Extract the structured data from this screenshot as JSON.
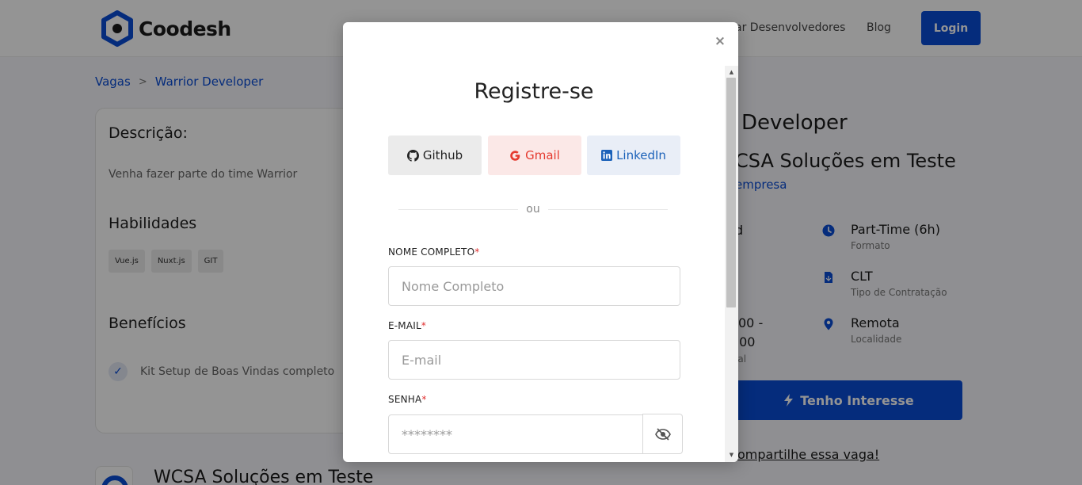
{
  "header": {
    "brand": "Coodesh",
    "nav_partial": "ar Desenvolvedores",
    "nav_blog": "Blog",
    "login_label": "Login"
  },
  "breadcrumb": {
    "items": [
      "Vagas",
      "Warrior Developer"
    ]
  },
  "job_details": {
    "description_title": "Descrição:",
    "description_text": "Venha fazer parte do time Warrior",
    "skills_title": "Habilidades",
    "skills": [
      "Vue.js",
      "Nuxt.js",
      "GIT"
    ],
    "benefits_title": "Benefícios",
    "benefits": [
      "Kit Setup de Boas Vindas completo"
    ]
  },
  "job_summary": {
    "title_partial": "Developer",
    "company_partial": "CSA Soluções em Teste",
    "company_link_partial": "empresa",
    "left_fragments": [
      "d",
      "00 -",
      ".00",
      "ial"
    ],
    "info": [
      {
        "value": "Part-Time (6h)",
        "label": "Formato",
        "icon": "clock-icon"
      },
      {
        "value": "CLT",
        "label": "Tipo de Contratação",
        "icon": "document-icon"
      },
      {
        "value": "Remota",
        "label": "Localidade",
        "icon": "location-icon"
      }
    ],
    "interest_button": "Tenho Interesse",
    "share_link": "ompartilhe essa vaga!",
    "bottom_company": "WCSA Soluções em Teste"
  },
  "modal": {
    "title": "Registre-se",
    "close_symbol": "×",
    "social": {
      "github": "Github",
      "gmail": "Gmail",
      "linkedin": "LinkedIn"
    },
    "divider_text": "ou",
    "fields": {
      "name": {
        "label": "NOME COMPLETO",
        "placeholder": "Nome Completo",
        "value": ""
      },
      "email": {
        "label": "E-MAIL",
        "placeholder": "E-mail",
        "value": ""
      },
      "password": {
        "label": "SENHA",
        "placeholder": "********",
        "value": ""
      }
    },
    "required_mark": "*"
  },
  "colors": {
    "primary": "#0a4cd6",
    "gmail": "#e53b30",
    "linkedin": "#1c62b9",
    "required": "#e02d2d"
  }
}
